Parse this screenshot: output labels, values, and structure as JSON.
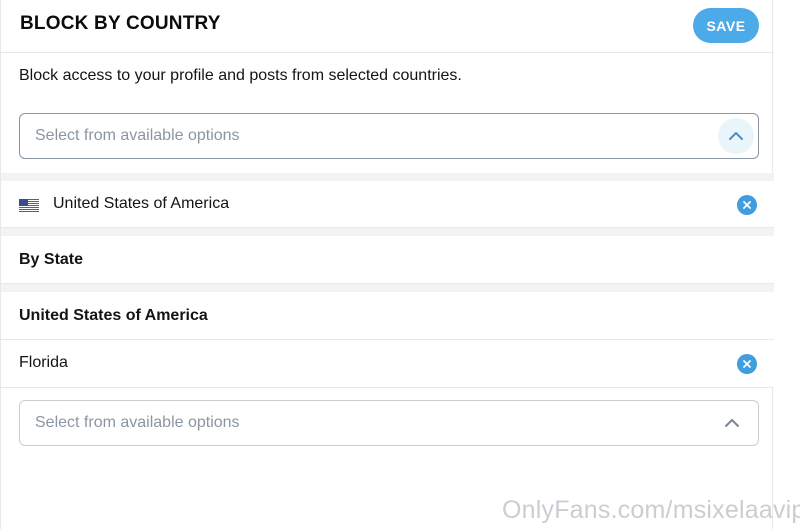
{
  "header": {
    "title": "BLOCK BY COUNTRY",
    "save_label": "SAVE"
  },
  "description": "Block access to your profile and posts from selected countries.",
  "country_select": {
    "placeholder": "Select from available options",
    "expanded": true
  },
  "selected_countries": [
    {
      "name": "United States of America",
      "flag": "us-flag-icon"
    }
  ],
  "by_state": {
    "heading": "By State",
    "country_heading": "United States of America",
    "selected_states": [
      {
        "name": "Florida"
      }
    ],
    "state_select": {
      "placeholder": "Select from available options"
    }
  },
  "watermark": "OnlyFans.com/msixelaavip",
  "colors": {
    "accent": "#4daae8",
    "remove": "#3f9de0",
    "placeholder": "#8a96a3"
  }
}
